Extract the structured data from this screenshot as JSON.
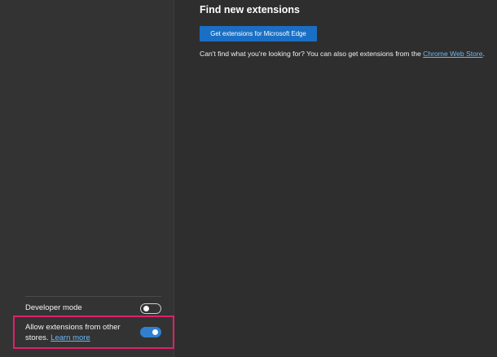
{
  "sidebar": {
    "developer_mode": {
      "label": "Developer mode",
      "enabled": false
    },
    "allow_other_stores": {
      "label": "Allow extensions from other stores.",
      "label_line1": "Allow extensions from other",
      "label_line2": "stores.",
      "learn_more": "Learn more",
      "enabled": true
    },
    "highlight_color": "#e0206a"
  },
  "main": {
    "title": "Find new extensions",
    "get_extensions_button": "Get extensions for Microsoft Edge",
    "info_prefix": "Can't find what you're looking for? You can also get extensions from the ",
    "info_link": "Chrome Web Store",
    "info_suffix": "."
  },
  "colors": {
    "accent": "#1a6fc4",
    "toggle_on": "#2f80d0",
    "link": "#6cb8f6",
    "background": "#2e2e2e"
  }
}
